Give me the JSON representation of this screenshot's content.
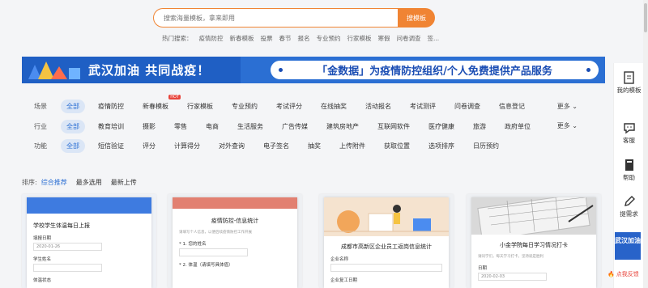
{
  "search": {
    "placeholder": "搜索海量模板，拿来即用",
    "button": "搜模板"
  },
  "hot": {
    "label": "热门搜索：",
    "items": [
      "疫情防控",
      "新春模板",
      "投票",
      "春节",
      "报名",
      "专业预约",
      "行家模板",
      "寒假",
      "问卷调查",
      "签..."
    ]
  },
  "banner": {
    "left": "武汉加油 共同战疫！",
    "right": "「金数据」为疫情防控组织/个人免费提供产品服务"
  },
  "filters": {
    "more": "更多",
    "rows": [
      {
        "label": "场景",
        "items": [
          "全部",
          "疫情防控",
          "新春模板",
          "行家模板",
          "专业预约",
          "考试评分",
          "在线抽奖",
          "活动报名",
          "考试测评",
          "问卷调查",
          "信息登记"
        ],
        "hot_index": 2,
        "hot": "HOT"
      },
      {
        "label": "行业",
        "items": [
          "全部",
          "教育培训",
          "摄影",
          "零售",
          "电商",
          "生活服务",
          "广告传媒",
          "建筑房地产",
          "互联网软件",
          "医疗健康",
          "旅游",
          "政府单位"
        ]
      },
      {
        "label": "功能",
        "items": [
          "全部",
          "短信验证",
          "评分",
          "计算得分",
          "对外查询",
          "电子签名",
          "抽奖",
          "上传附件",
          "获取位置",
          "选项排序",
          "日历预约"
        ]
      }
    ]
  },
  "sort": {
    "label": "排序:",
    "items": [
      "综合推荐",
      "最多选用",
      "最新上传"
    ]
  },
  "cards": [
    {
      "title": "学校学生体温每日上报",
      "f1": "填报日期",
      "v1": "2020-01-26",
      "f2": "学生姓名",
      "f3": "体温状态"
    },
    {
      "title": "疫情防控-信息统计",
      "text": "请填写个人信息，以便后续疫情防控工作开展",
      "f1": "* 1. 您的姓名",
      "f2": "* 2. 体温（请填写具体值）"
    },
    {
      "title": "成都市高新区企业员工返岗信息统计",
      "f1": "企业名称",
      "f2": "企业复工日期"
    },
    {
      "title": "小金学院每日学习情况打卡",
      "text": "请同学们，每天学习打卡，坚持就是胜利",
      "f1": "日期",
      "v1": "2020-02-03"
    }
  ],
  "sidebar": {
    "items": [
      "我的模板",
      "客服",
      "帮助",
      "提需求"
    ],
    "ad": "武汉加油",
    "report": "点我反馈"
  }
}
